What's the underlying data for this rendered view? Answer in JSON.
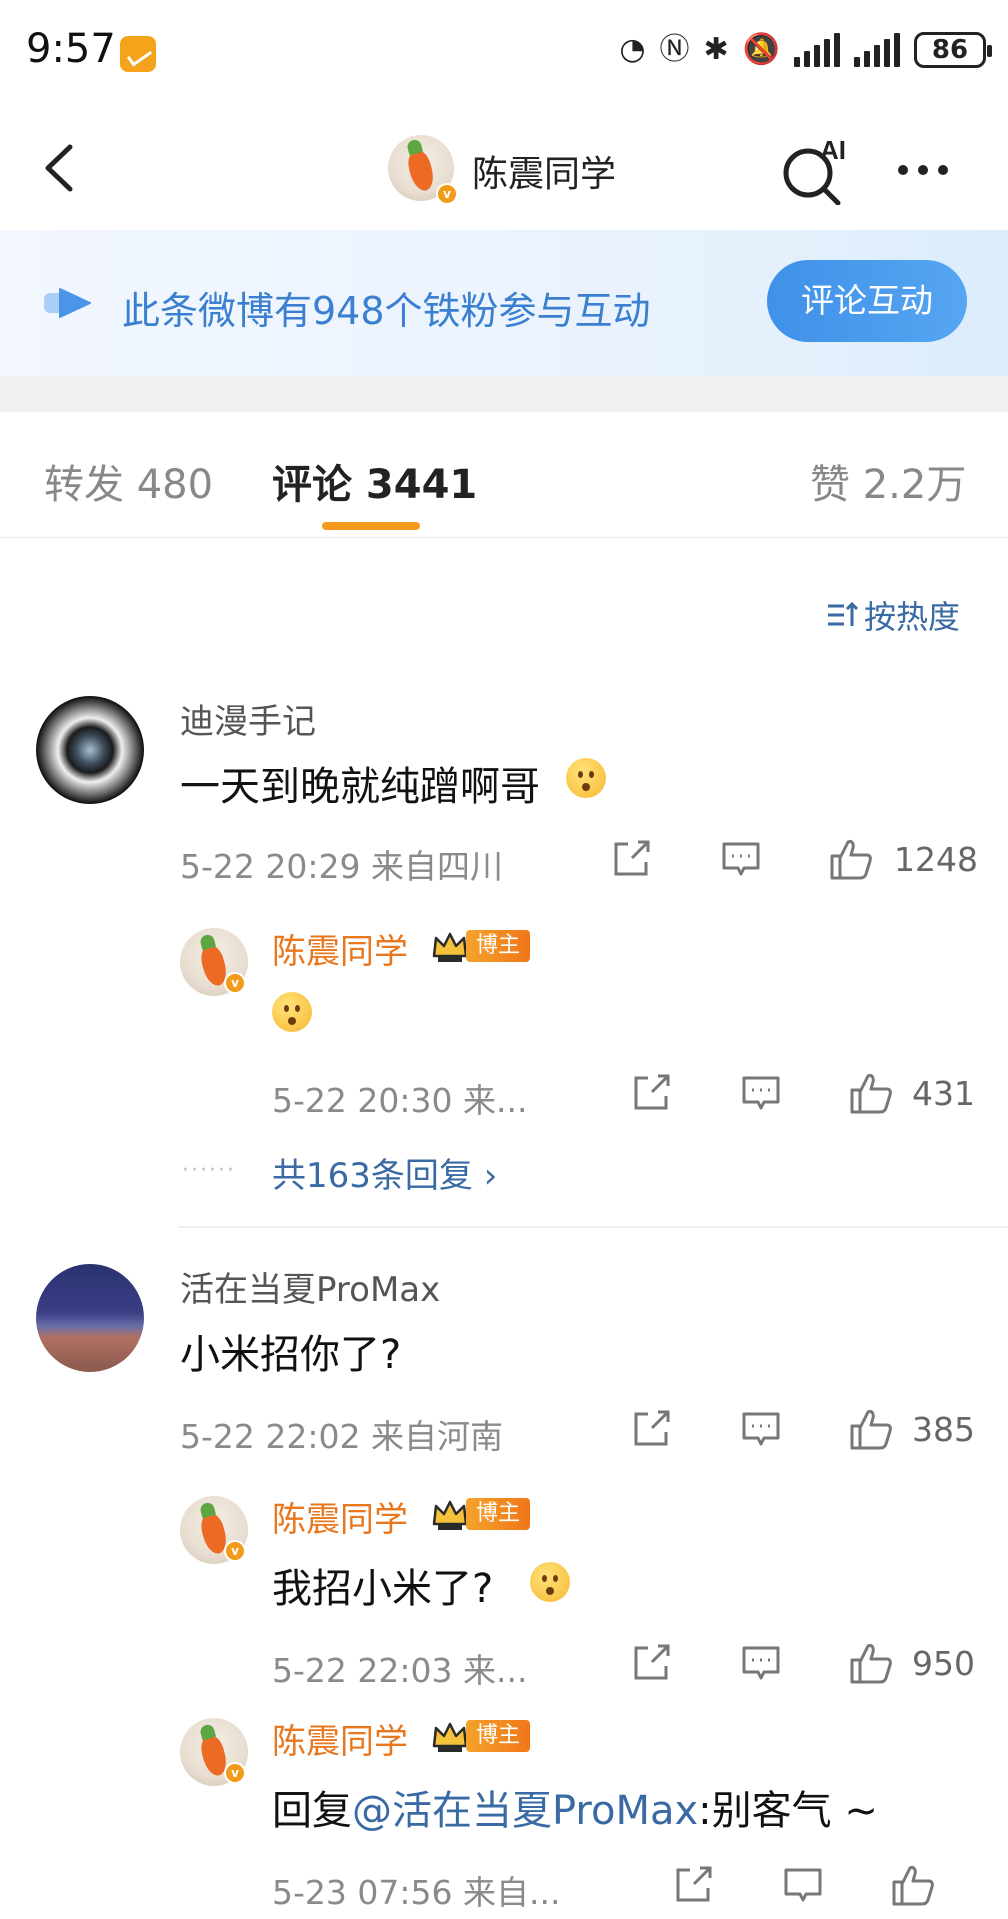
{
  "status_bar": {
    "time": "9:57",
    "battery": "86"
  },
  "header": {
    "title": "陈震同学",
    "ai_label": "AI"
  },
  "banner": {
    "text": "此条微博有948个铁粉参与互动",
    "button": "评论互动"
  },
  "tabs": [
    {
      "label": "转发 480"
    },
    {
      "label": "评论 3441",
      "active": true
    },
    {
      "label": "赞 2.2万"
    }
  ],
  "sort": {
    "label": "按热度"
  },
  "comments": [
    {
      "author": "迪漫手记",
      "text": "一天到晚就纯蹭啊哥",
      "meta": "5-22 20:29  来自四川",
      "likes": "1248",
      "replies": [
        {
          "author": "陈震同学",
          "tag": "博主",
          "meta": "5-22 20:30  来...",
          "likes": "431"
        }
      ],
      "more_replies": "共163条回复 ›"
    },
    {
      "author": "活在当夏ProMax",
      "text": "小米招你了?",
      "meta": "5-22 22:02  来自河南",
      "likes": "385",
      "replies": [
        {
          "author": "陈震同学",
          "tag": "博主",
          "text": "我招小米了?",
          "meta": "5-22 22:03  来...",
          "likes": "950"
        },
        {
          "author": "陈震同学",
          "tag": "博主",
          "text_prefix": "回复",
          "mention": "@活在当夏ProMax",
          "text_suffix": ":别客气 ~",
          "meta": "5-23 07:56  来自..."
        }
      ]
    }
  ],
  "colors": {
    "accent_orange": "#f39a1b",
    "link_blue": "#3a6aa3",
    "banner_blue": "#3b7fd1"
  },
  "icons": [
    "back-icon",
    "ai-search-icon",
    "more-icon",
    "share-icon",
    "comment-icon",
    "like-icon",
    "crown-icon"
  ]
}
